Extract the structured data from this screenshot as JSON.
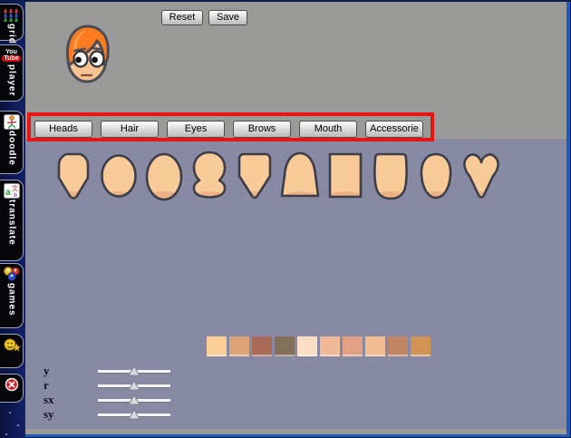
{
  "window": {
    "frame_navy": "#0c1747",
    "border_blue": "#1f5bbd",
    "top_gray": "#9a9a99",
    "panel_purple": "#8889a3",
    "bottom_strip": "#9b9b93"
  },
  "sidebar": {
    "youtube_logo": {
      "line1": "You",
      "line2": "Tube"
    },
    "items": [
      {
        "id": "grid",
        "label": "grid",
        "icon": "people-grid-icon"
      },
      {
        "id": "player",
        "label": "player",
        "icon": "youtube-icon"
      },
      {
        "id": "doodle",
        "label": "doodle",
        "icon": "doodle-figure-icon"
      },
      {
        "id": "translate",
        "label": "translate",
        "icon": "translate-icon"
      },
      {
        "id": "games",
        "label": "games",
        "icon": "billiard-balls-icon"
      },
      {
        "id": "emotes",
        "label": "",
        "icon": "smiley-star-icon"
      },
      {
        "id": "close",
        "label": "",
        "icon": "close-icon"
      }
    ]
  },
  "toolbar": {
    "reset_label": "Reset",
    "save_label": "Save"
  },
  "categories": {
    "highlight_color": "#e81414",
    "items": [
      "Heads",
      "Hair",
      "Eyes",
      "Brows",
      "Mouth",
      "Accessorie"
    ]
  },
  "avatar_preview": {
    "description": "avatar head with orange swept hair, large eyes looking left, neutral mouth",
    "hair_color": "#fd7a1e",
    "skin_color": "#f6c392"
  },
  "head_shapes": {
    "skin_fill": "#f9cb98",
    "shadow_fill": "#ecb286",
    "outline": "#3e3e49",
    "shapes": [
      "hexagon",
      "circle",
      "egg",
      "snowman",
      "shield",
      "dome",
      "square",
      "rounded-square",
      "teardrop",
      "heart"
    ]
  },
  "skin_swatches": [
    "#fccf96",
    "#dca377",
    "#a96a57",
    "#82705b",
    "#f9ddc4",
    "#efb897",
    "#e2a185",
    "#f2bd93",
    "#bf8565",
    "#d29455"
  ],
  "sliders": {
    "items": [
      {
        "label": "y",
        "value": 50
      },
      {
        "label": "r",
        "value": 50
      },
      {
        "label": "sx",
        "value": 50
      },
      {
        "label": "sy",
        "value": 50
      }
    ]
  }
}
